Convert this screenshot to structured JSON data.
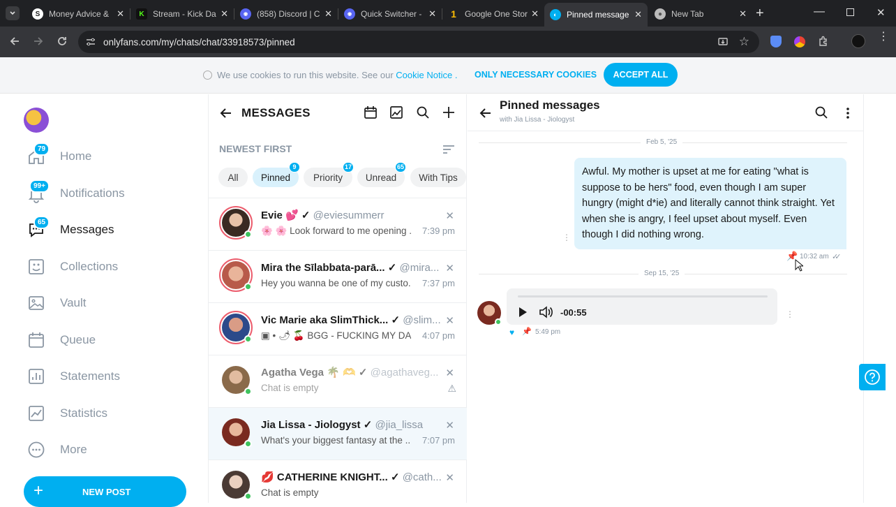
{
  "browser": {
    "tabs": [
      {
        "title": "Money Advice &",
        "favicon": "money-icon",
        "active": false
      },
      {
        "title": "Stream - Kick Da",
        "favicon": "kick-icon",
        "active": false
      },
      {
        "title": "(858) Discord | C",
        "favicon": "discord-icon",
        "active": false
      },
      {
        "title": "Quick Switcher -",
        "favicon": "discord-icon",
        "active": false
      },
      {
        "title": "Google One Stor",
        "favicon": "google-one-icon",
        "active": false
      },
      {
        "title": "Pinned message",
        "favicon": "onlyfans-icon",
        "active": true
      },
      {
        "title": "New Tab",
        "favicon": "chrome-icon",
        "active": false
      }
    ],
    "url": "onlyfans.com/my/chats/chat/33918573/pinned"
  },
  "cookie_bar": {
    "text": "We use cookies to run this website. See our",
    "link": "Cookie Notice",
    "link_suffix": ".",
    "necessary_label": "ONLY NECESSARY COOKIES",
    "accept_label": "ACCEPT ALL"
  },
  "sidebar": {
    "items": [
      {
        "label": "Home",
        "icon": "home-icon",
        "badge": "79"
      },
      {
        "label": "Notifications",
        "icon": "bell-icon",
        "badge": "99+"
      },
      {
        "label": "Messages",
        "icon": "chat-icon",
        "badge": "65",
        "active": true
      },
      {
        "label": "Collections",
        "icon": "collections-icon"
      },
      {
        "label": "Vault",
        "icon": "vault-icon"
      },
      {
        "label": "Queue",
        "icon": "calendar-icon"
      },
      {
        "label": "Statements",
        "icon": "statements-icon"
      },
      {
        "label": "Statistics",
        "icon": "statistics-icon"
      },
      {
        "label": "More",
        "icon": "more-icon"
      }
    ],
    "new_post_label": "NEW POST"
  },
  "messages": {
    "title": "MESSAGES",
    "sort_label": "NEWEST FIRST",
    "filters": [
      {
        "label": "All"
      },
      {
        "label": "Pinned",
        "badge": "9",
        "selected": true
      },
      {
        "label": "Priority",
        "badge": "17"
      },
      {
        "label": "Unread",
        "badge": "65"
      },
      {
        "label": "With Tips"
      }
    ],
    "conversations": [
      {
        "name": "Evie",
        "emoji": "💕",
        "handle": "@eviesummerr",
        "preview": "🌸 🌸 Look forward to me opening ...",
        "time": "7:39 pm"
      },
      {
        "name": "Mira the Sīlabbata-parā...",
        "emoji": "",
        "handle": "@mira...",
        "preview": "Hey you wanna be one of my custo...",
        "time": "7:37 pm"
      },
      {
        "name": "Vic Marie aka SlimThick...",
        "emoji": "",
        "handle": "@slim...",
        "preview": "▣ • 🌶 🍒 BGG - FUCKING MY DAD...",
        "time": "4:07 pm"
      },
      {
        "name": "Agatha Vega",
        "emoji": "🌴 🫶",
        "handle": "@agathaveg...",
        "preview": "Chat is empty",
        "time": ""
      },
      {
        "name": "Jia Lissa - Jiologyst",
        "emoji": "",
        "handle": "@jia_lissa",
        "preview": "What's your biggest fantasy at the ...",
        "time": "7:07 pm"
      },
      {
        "name": "CATHERINE KNIGHT...",
        "emoji": "💋",
        "handle": "@cath...",
        "preview": "Chat is empty",
        "time": ""
      }
    ]
  },
  "chat": {
    "title": "Pinned messages",
    "subtitle": "with Jia Lissa - Jiologyst",
    "date1": "Feb 5, '25",
    "message_text": "Awful. My mother is upset at me for eating \"what is suppose to be hers\" food, even though I am super hungry (might d*ie) and literally cannot think straight. Yet when she is angry, I feel upset about myself. Even though I did nothing wrong.",
    "message_time": "10:32 am",
    "date2": "Sep 15, '25",
    "audio_time": "-00:55",
    "audio_msg_time": "5:49 pm"
  },
  "colors": {
    "accent": "#00aff0",
    "text_muted": "#8a96a3",
    "bubble": "#dff3fc"
  }
}
